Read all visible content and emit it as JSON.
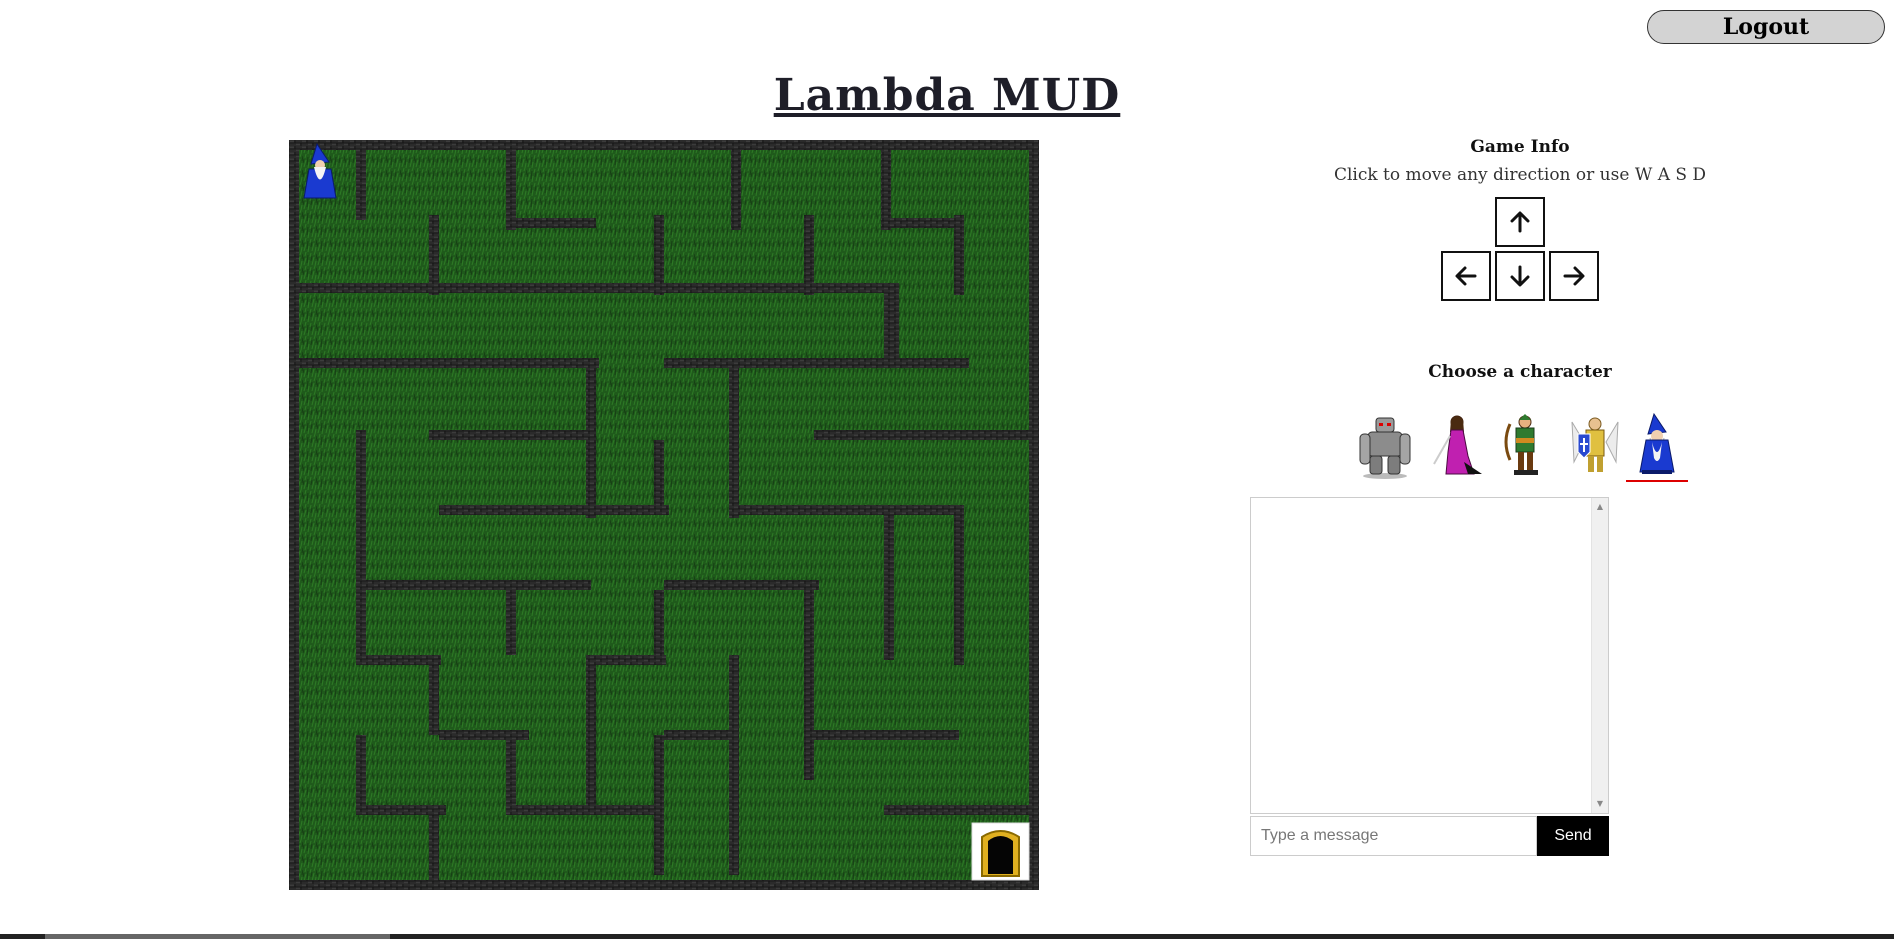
{
  "header": {
    "logout_label": "Logout",
    "title": "Lambda MUD"
  },
  "game_info": {
    "title": "Game Info",
    "instructions": "Click to move any direction or use W A S D",
    "controls": [
      {
        "name": "up",
        "icon": "arrow-up-icon"
      },
      {
        "name": "left",
        "icon": "arrow-left-icon"
      },
      {
        "name": "down",
        "icon": "arrow-down-icon"
      },
      {
        "name": "right",
        "icon": "arrow-right-icon"
      }
    ]
  },
  "characters": {
    "title": "Choose a character",
    "options": [
      "stone-golem",
      "sorceress",
      "archer",
      "paladin",
      "wizard"
    ],
    "selected": "wizard"
  },
  "maze": {
    "grid_size": 10,
    "player": {
      "sprite": "wizard",
      "row": 0,
      "col": 0
    },
    "exit": {
      "sprite": "golden-door",
      "row": 9,
      "col": 9
    },
    "colors": {
      "grass": "#1f5a1b",
      "grass_dark": "#16421a",
      "wall": "#2a2a2a",
      "exit_frame": "#e0b020"
    }
  },
  "chat": {
    "placeholder": "Type a message",
    "send_label": "Send"
  }
}
